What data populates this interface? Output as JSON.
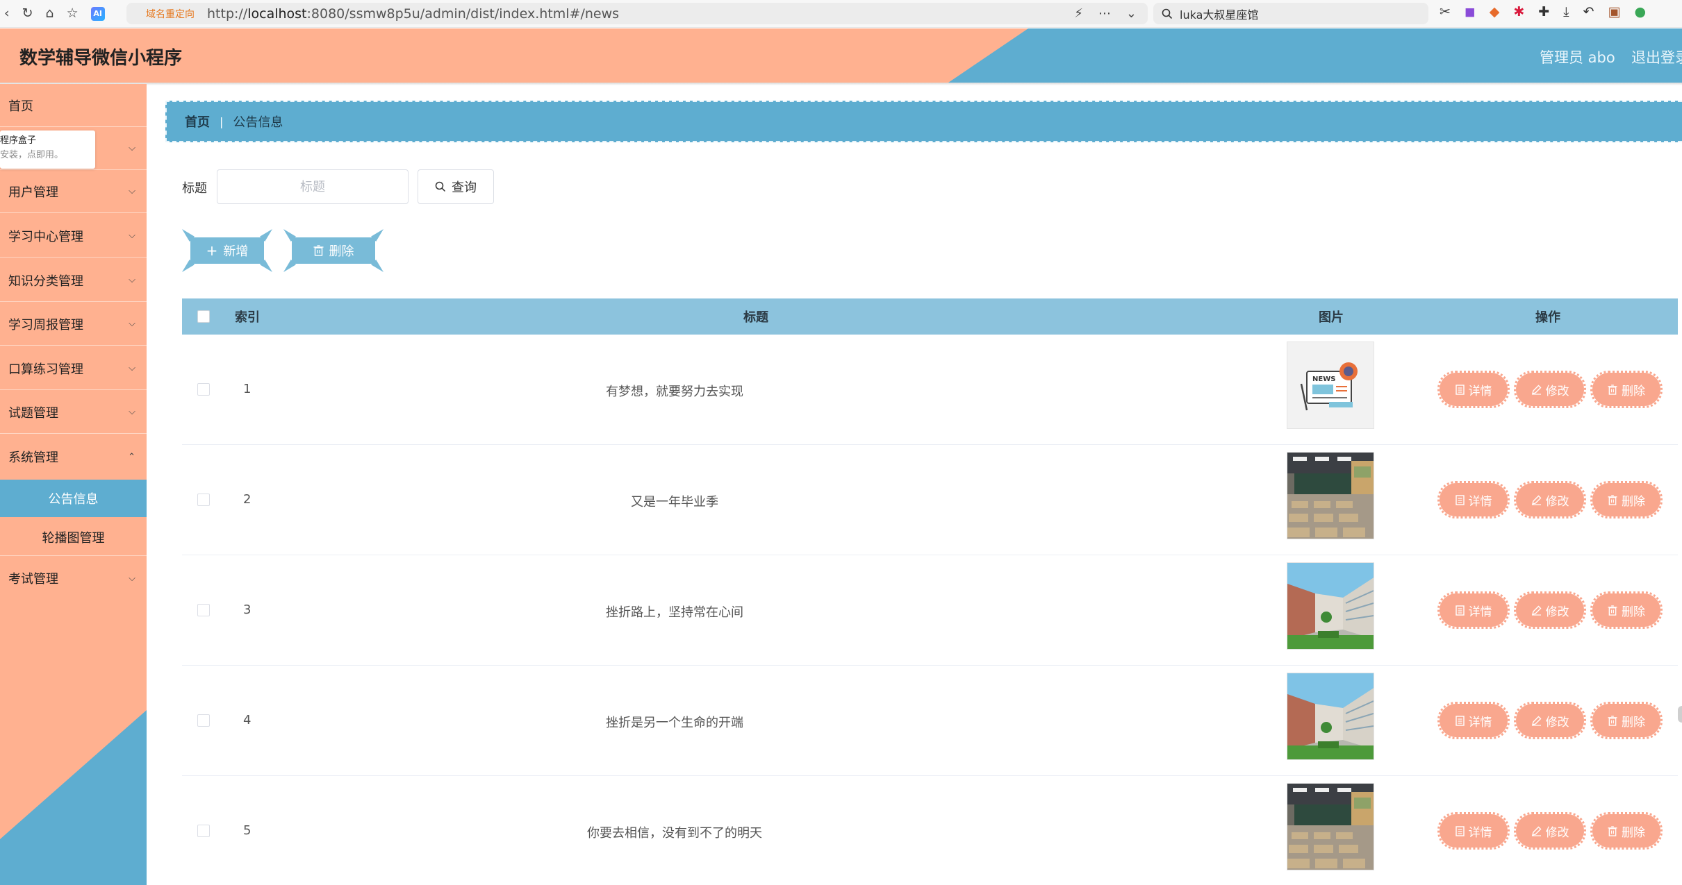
{
  "browser": {
    "redirect_tag": "域名重定向",
    "url_prefix": "http://",
    "url_host": "localhost",
    "url_rest": ":8080/ssmw8p5u/admin/dist/index.html#/news",
    "search_text": "luka大叔星座馆",
    "ai_badge": "AI"
  },
  "header": {
    "title": "数学辅导微信小程序",
    "admin_label": "管理员 abo",
    "logout_label": "退出登录"
  },
  "sidebar": {
    "popup_line1": "程序盒子",
    "popup_line2": "安装，点即用。",
    "items": [
      {
        "label": "首页"
      },
      {
        "label": "用户管理"
      },
      {
        "label": "学习中心管理"
      },
      {
        "label": "知识分类管理"
      },
      {
        "label": "学习周报管理"
      },
      {
        "label": "口算练习管理"
      },
      {
        "label": "试题管理"
      },
      {
        "label": "系统管理"
      },
      {
        "label": "考试管理"
      }
    ],
    "submenu": [
      {
        "label": "公告信息",
        "active": true
      },
      {
        "label": "轮播图管理",
        "active": false
      }
    ]
  },
  "breadcrumb": {
    "home": "首页",
    "separator": "|",
    "current": "公告信息"
  },
  "search": {
    "label": "标题",
    "placeholder": "标题",
    "value": "",
    "query_label": "查询"
  },
  "actions": {
    "add_label": "新增",
    "delete_label": "删除"
  },
  "table": {
    "headers": {
      "index": "索引",
      "title": "标题",
      "image": "图片",
      "operation": "操作"
    },
    "op_labels": {
      "detail": "详情",
      "edit": "修改",
      "delete": "删除"
    },
    "rows": [
      {
        "index": "1",
        "title": "有梦想，就要努力去实现",
        "image": "news-illustration"
      },
      {
        "index": "2",
        "title": "又是一年毕业季",
        "image": "classroom-photo"
      },
      {
        "index": "3",
        "title": "挫折路上，坚持常在心间",
        "image": "campus-building-photo"
      },
      {
        "index": "4",
        "title": "挫折是另一个生命的开端",
        "image": "campus-building-photo"
      },
      {
        "index": "5",
        "title": "你要去相信，没有到不了的明天",
        "image": "classroom-photo"
      }
    ]
  },
  "colors": {
    "peach": "#ffb190",
    "blue": "#5eadd0",
    "header_blue": "#8cc3dd",
    "op_button": "#f9a78e"
  }
}
